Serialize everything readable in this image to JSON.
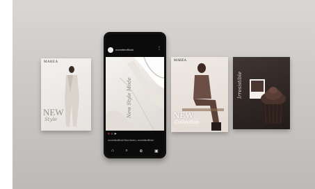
{
  "colors": {
    "backdrop": "#c9c6c3",
    "phone_body": "#111111",
    "instagram_heart": "#e0245e",
    "dark_card": "#2b2220",
    "cupcake": "#3b2a26"
  },
  "cards": {
    "card1": {
      "brand": "MAREA",
      "title_main": "NEW",
      "title_script": "Style"
    },
    "card3": {
      "brand": "MAREA",
      "title_main": "NEW",
      "title_script": "Collection"
    },
    "card4": {
      "vertical_word": "Irresistible",
      "swatch_label": ""
    }
  },
  "phone": {
    "username": "monetteofficial",
    "post_vertical_text": "New Style Mode",
    "caption": "monetteofficial  New items • monetteofficial",
    "icons": [
      "heart-icon",
      "comment-icon",
      "share-icon"
    ],
    "nav_icons": [
      "home-icon",
      "search-icon",
      "add-icon",
      "shop-icon"
    ]
  }
}
